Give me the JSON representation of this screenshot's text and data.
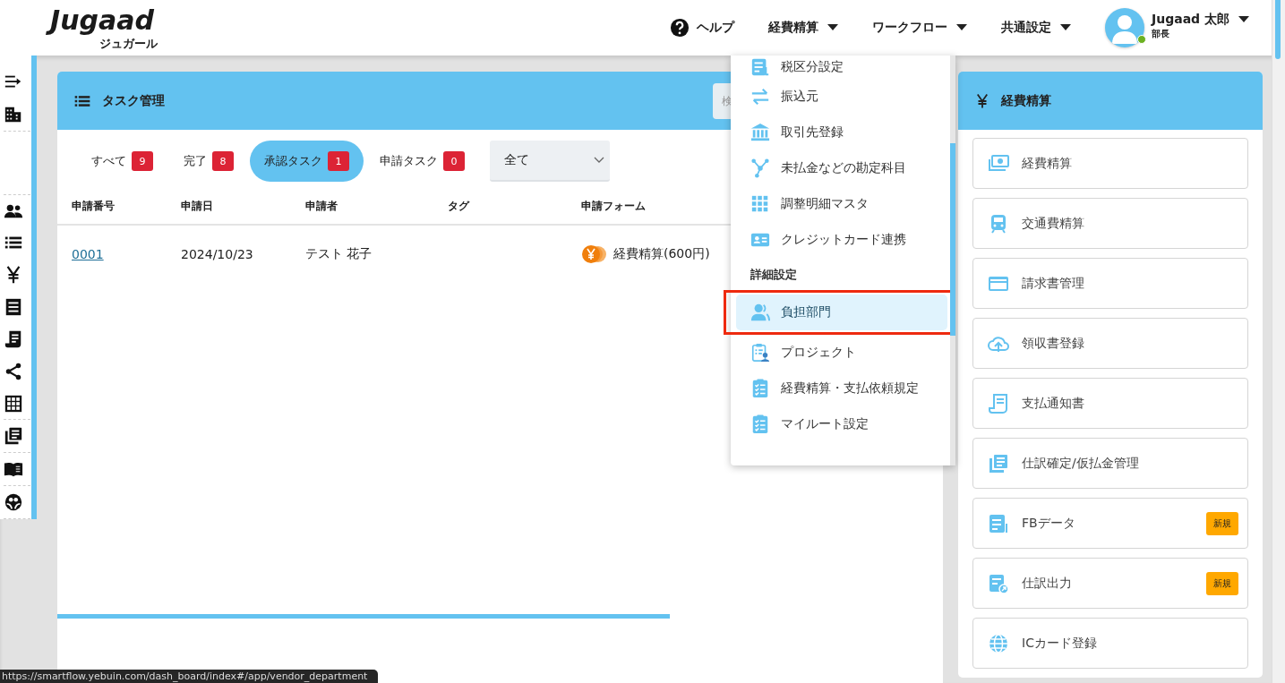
{
  "header": {
    "logo": "Jugaad",
    "logo_sub": "ジュガール",
    "nav": [
      {
        "kind": "help",
        "label": "ヘルプ"
      },
      {
        "kind": "menu",
        "label": "経費精算"
      },
      {
        "kind": "menu",
        "label": "ワークフロー"
      },
      {
        "kind": "menu",
        "label": "共通設定"
      }
    ],
    "user": {
      "name": "Jugaad 太郎",
      "role": "部長",
      "online": true
    }
  },
  "task_panel": {
    "title": "タスク管理",
    "search": {
      "placeholder": "検"
    },
    "filters": [
      {
        "label": "すべて",
        "count": "9",
        "selected": false
      },
      {
        "label": "完了",
        "count": "8",
        "selected": false
      },
      {
        "label": "承認タスク",
        "count": "1",
        "selected": true
      },
      {
        "label": "申請タスク",
        "count": "0",
        "selected": false
      }
    ],
    "select": {
      "value": "全て"
    },
    "table": {
      "columns": [
        "申請番号",
        "申請日",
        "申請者",
        "タグ",
        "申請フォーム"
      ],
      "rows": [
        {
          "number": "0001",
          "date": "2024/10/23",
          "applicant": "テスト 花子",
          "form": "経費精算(600円)"
        }
      ]
    }
  },
  "dropdown": {
    "items": [
      {
        "kind": "item",
        "label": "税区分設定",
        "selected": false,
        "outlined": false
      },
      {
        "kind": "item",
        "label": "振込元",
        "selected": false,
        "outlined": false
      },
      {
        "kind": "item",
        "label": "取引先登録",
        "selected": false,
        "outlined": false
      },
      {
        "kind": "item",
        "label": "未払金などの勘定科目",
        "selected": false,
        "outlined": false
      },
      {
        "kind": "item",
        "label": "調整明細マスタ",
        "selected": false,
        "outlined": false
      },
      {
        "kind": "item",
        "label": "クレジットカード連携",
        "selected": false,
        "outlined": false
      },
      {
        "kind": "section",
        "label": "詳細設定"
      },
      {
        "kind": "item",
        "label": "負担部門",
        "selected": true,
        "outlined": true
      },
      {
        "kind": "item",
        "label": "プロジェクト",
        "selected": false,
        "outlined": false
      },
      {
        "kind": "item",
        "label": "経費精算・支払依頼規定",
        "selected": false,
        "outlined": false
      },
      {
        "kind": "item",
        "label": "マイルート設定",
        "selected": false,
        "outlined": false
      }
    ]
  },
  "expense_panel": {
    "title": "経費精算",
    "items": [
      {
        "label": "経費精算"
      },
      {
        "label": "交通費精算"
      },
      {
        "label": "請求書管理"
      },
      {
        "label": "領収書登録"
      },
      {
        "label": "支払通知書"
      },
      {
        "label": "仕訳確定/仮払金管理"
      },
      {
        "label": "FBデータ",
        "badge": "新規"
      },
      {
        "label": "仕訳出力",
        "badge": "新規"
      },
      {
        "label": "ICカード登録"
      }
    ]
  },
  "status_bar": {
    "url": "https://smartflow.yebuin.com/dash_board/index#/app/vendor_department"
  }
}
